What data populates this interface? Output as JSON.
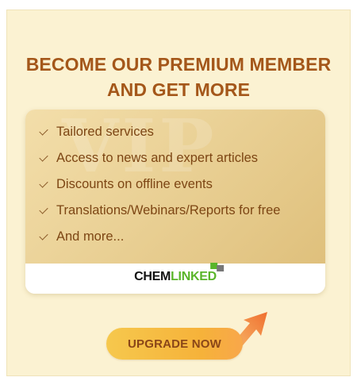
{
  "promo": {
    "headline_line1": "BECOME OUR PREMIUM MEMBER",
    "headline_line2": "AND GET MORE",
    "watermark": "VIP",
    "benefits": [
      "Tailored services",
      "Access to news and expert articles",
      "Discounts on offline events",
      "Translations/Webinars/Reports for free",
      "And more..."
    ],
    "logo_part1": "CHEM",
    "logo_part2": "LINKED",
    "cta_label": "UPGRADE NOW"
  },
  "colors": {
    "panel_bg": "#fbf2d2",
    "headline": "#a4571a",
    "benefit_text": "#7d4614",
    "cta_gradient_start": "#f6c84d",
    "cta_gradient_end": "#f8a74a",
    "logo_green": "#59b52a",
    "arrow_orange": "#f07b3a"
  },
  "icons": [
    "check-icon",
    "arrow-up-right-icon",
    "chemlinked-logo"
  ]
}
